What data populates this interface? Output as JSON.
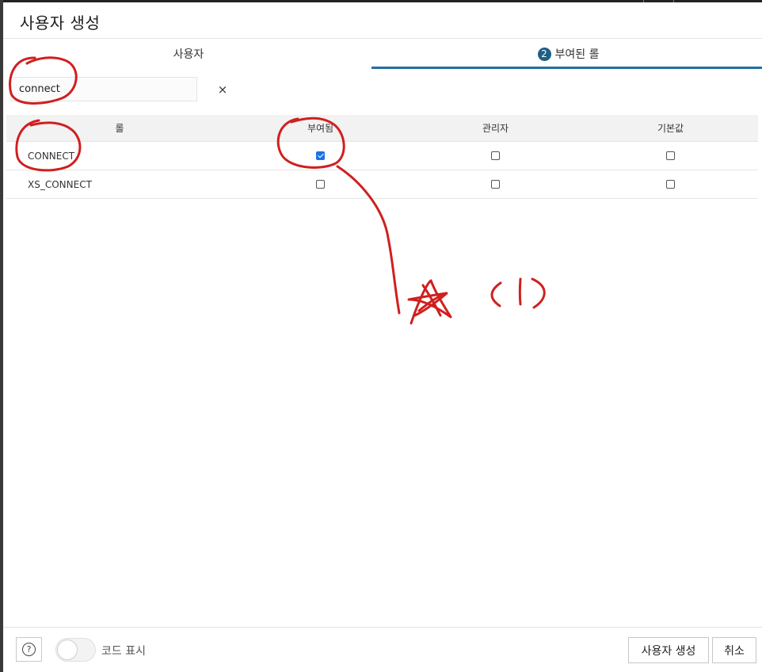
{
  "dialog": {
    "title": "사용자 생성"
  },
  "tabs": {
    "user": "사용자",
    "roles_step": "2",
    "roles": "부여된 롤"
  },
  "search": {
    "value": "connect",
    "clear": "×"
  },
  "grid": {
    "headers": {
      "role": "롤",
      "granted": "부여됨",
      "admin": "관리자",
      "default": "기본값"
    },
    "rows": [
      {
        "role": "CONNECT",
        "granted": true,
        "admin": false,
        "default": false
      },
      {
        "role": "XS_CONNECT",
        "granted": false,
        "admin": false,
        "default": false
      }
    ]
  },
  "footer": {
    "help": "?",
    "show_code": "코드 표시",
    "create": "사용자 생성",
    "cancel": "취소"
  },
  "colors": {
    "accent": "#2270a3",
    "annotation": "#d01f1f"
  }
}
